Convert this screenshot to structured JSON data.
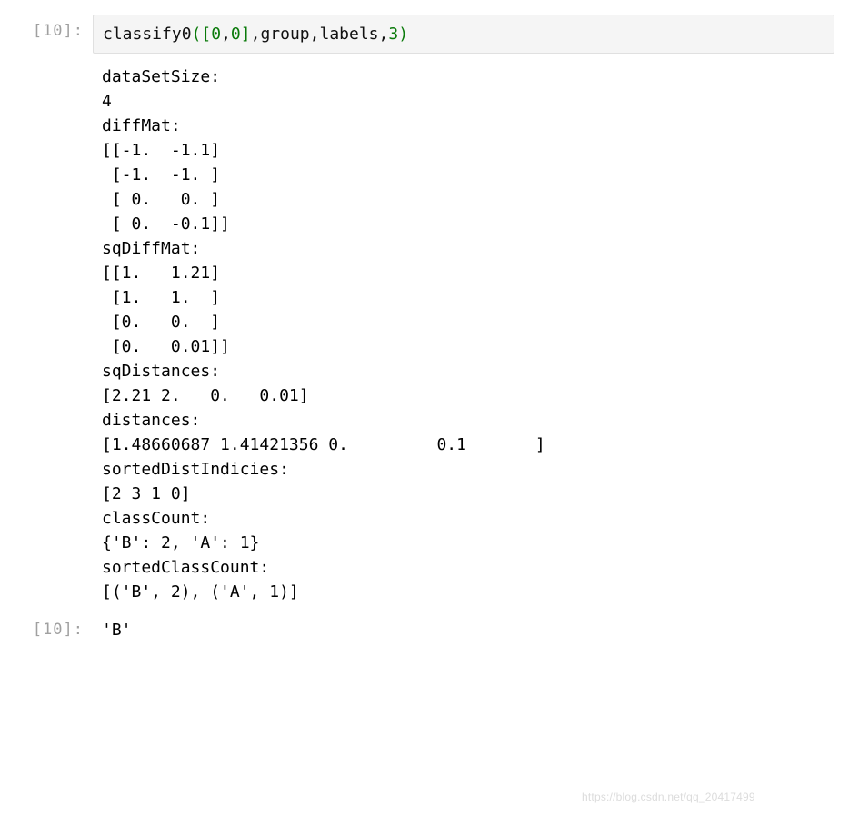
{
  "input_cell": {
    "prompt": "[10]:",
    "code_tokens": {
      "fn": "classify0",
      "open_paren": "(",
      "open_bracket": "[",
      "arg_list_num1": "0",
      "comma1": ",",
      "arg_list_num2": "0",
      "close_bracket": "]",
      "comma2": ",",
      "arg2": "group",
      "comma3": ",",
      "arg3": "labels",
      "comma4": ",",
      "arg4": "3",
      "close_paren": ")"
    }
  },
  "stdout": {
    "text": "dataSetSize:\n4\ndiffMat:\n[[-1.  -1.1]\n [-1.  -1. ]\n [ 0.   0. ]\n [ 0.  -0.1]]\nsqDiffMat:\n[[1.   1.21]\n [1.   1.  ]\n [0.   0.  ]\n [0.   0.01]]\nsqDistances:\n[2.21 2.   0.   0.01]\ndistances:\n[1.48660687 1.41421356 0.         0.1       ]\nsortedDistIndicies:\n[2 3 1 0]\nclassCount:\n{'B': 2, 'A': 1}\nsortedClassCount:\n[('B', 2), ('A', 1)]"
  },
  "result_cell": {
    "prompt": "[10]:",
    "value": "'B'"
  },
  "watermark": "https://blog.csdn.net/qq_20417499"
}
